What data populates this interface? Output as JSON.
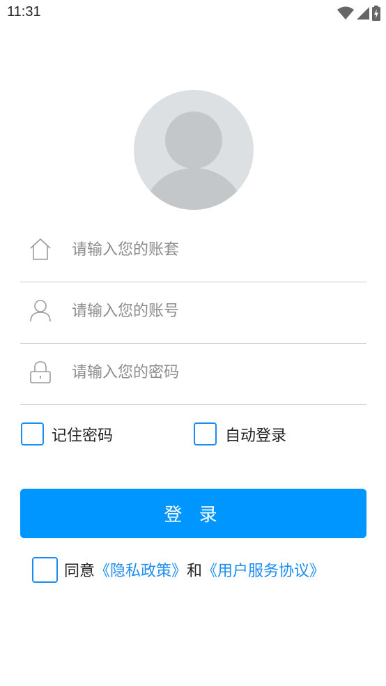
{
  "status_bar": {
    "time": "11:31"
  },
  "form": {
    "account_set_placeholder": "请输入您的账套",
    "account_placeholder": "请输入您的账号",
    "password_placeholder": "请输入您的密码"
  },
  "options": {
    "remember_password": "记住密码",
    "auto_login": "自动登录"
  },
  "login_button": "登 录",
  "agreement": {
    "prefix": "同意",
    "privacy_policy": "《隐私政策》",
    "and": "和",
    "user_agreement": "《用户服务协议》"
  },
  "colors": {
    "accent": "#0096ff",
    "link": "#1b8cf2",
    "avatar_bg": "#dde0e3"
  }
}
